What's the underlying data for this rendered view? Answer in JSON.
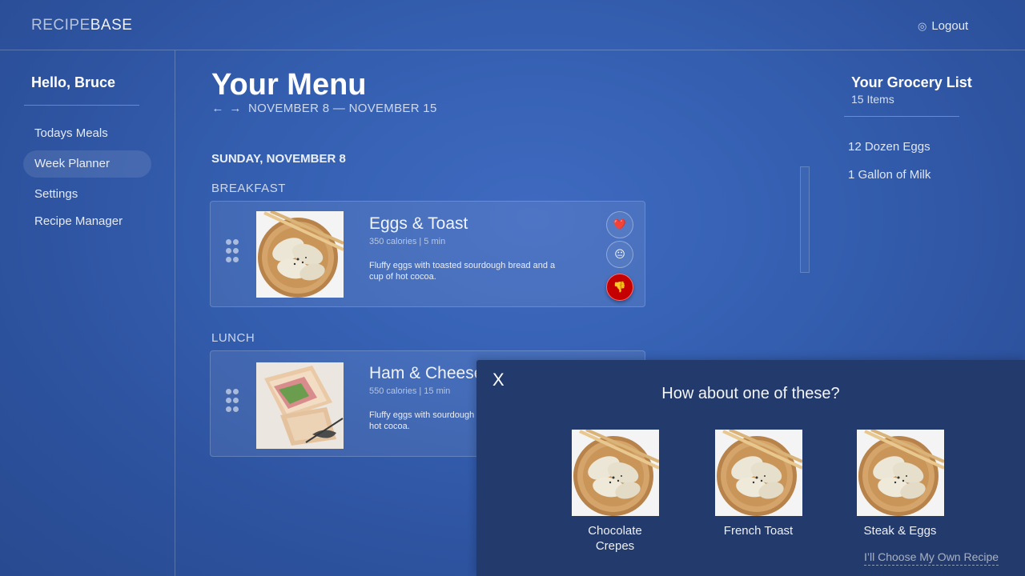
{
  "app": {
    "logo_light": "RECIPE",
    "logo_bold": "BASE"
  },
  "header": {
    "logout_label": "Logout",
    "logout_icon": "settings-circle-icon"
  },
  "sidebar": {
    "greeting": "Hello, Bruce",
    "items": [
      {
        "label": "Todays Meals",
        "active": false
      },
      {
        "label": "Week Planner",
        "active": true
      },
      {
        "label": "Settings",
        "active": false
      },
      {
        "label": "Recipe Manager",
        "active": false
      }
    ]
  },
  "menu": {
    "title": "Your Menu",
    "prev_arrow": "←",
    "next_arrow": "→",
    "date_range": "NOVEMBER 8 — NOVEMBER 15",
    "day": "SUNDAY, NOVEMBER 8",
    "meals": [
      {
        "label": "BREAKFAST",
        "name": "Eggs & Toast",
        "meta": "350 calories | 5 min",
        "description": "Fluffy eggs with toasted sourdough bread and a cup of hot cocoa.",
        "image": "dumplings-bowl",
        "reactions": [
          {
            "icon": "heart-icon",
            "glyph": "❤️",
            "selected": false
          },
          {
            "icon": "neutral-face-icon",
            "glyph": "😐",
            "selected": false
          },
          {
            "icon": "thumbs-down-icon",
            "glyph": "👎",
            "selected": true
          }
        ]
      },
      {
        "label": "LUNCH",
        "name": "Ham & Cheese",
        "meta": "550 calories | 15 min",
        "description": "Fluffy eggs with sourdough hot cocoa.",
        "image": "sandwich"
      }
    ]
  },
  "grocery": {
    "title": "Your Grocery List",
    "count": "15 Items",
    "items": [
      "12 Dozen Eggs",
      "1 Gallon of Milk"
    ]
  },
  "modal": {
    "close_label": "X",
    "title": "How about one of these?",
    "suggestions": [
      {
        "name": "Chocolate Crepes",
        "image": "dumplings-bowl"
      },
      {
        "name": "French Toast",
        "image": "dumplings-bowl"
      },
      {
        "name": "Steak & Eggs",
        "image": "dumplings-bowl"
      }
    ],
    "choose_own": "I’ll Choose My Own Recipe"
  },
  "colors": {
    "accent_red": "#c40000",
    "modal_bg": "#223a6c",
    "page_bg": "#3560b2"
  }
}
